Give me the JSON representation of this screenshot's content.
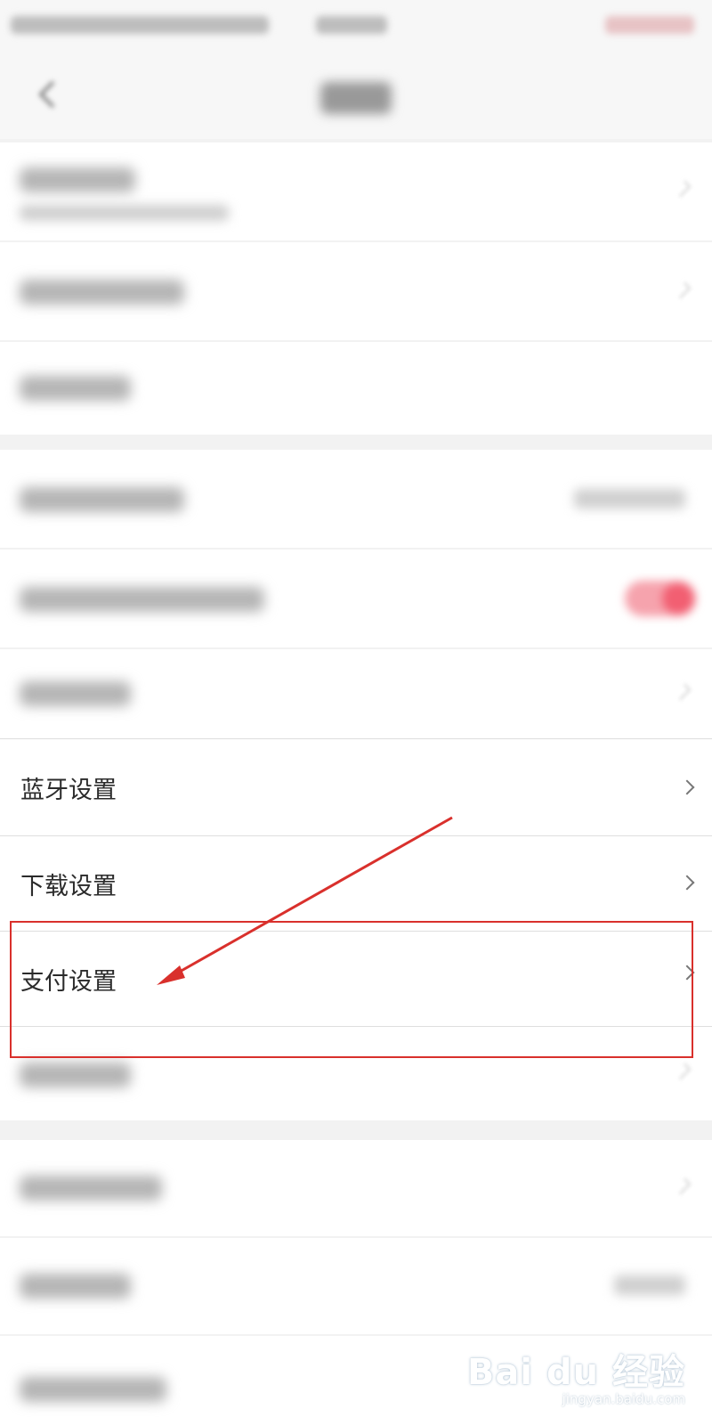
{
  "settings_list": {
    "items": [
      {
        "label": "蓝牙设置",
        "chevron_icon": "chevron-right-icon"
      },
      {
        "label": "下载设置",
        "chevron_icon": "chevron-right-icon"
      },
      {
        "label": "支付设置",
        "chevron_icon": "chevron-right-icon"
      }
    ]
  },
  "annotation": {
    "box_color": "#d9302c",
    "arrow_color": "#d9302c"
  },
  "watermark": {
    "logo": "Bai du 经验",
    "url": "jingyan.baidu.com"
  }
}
